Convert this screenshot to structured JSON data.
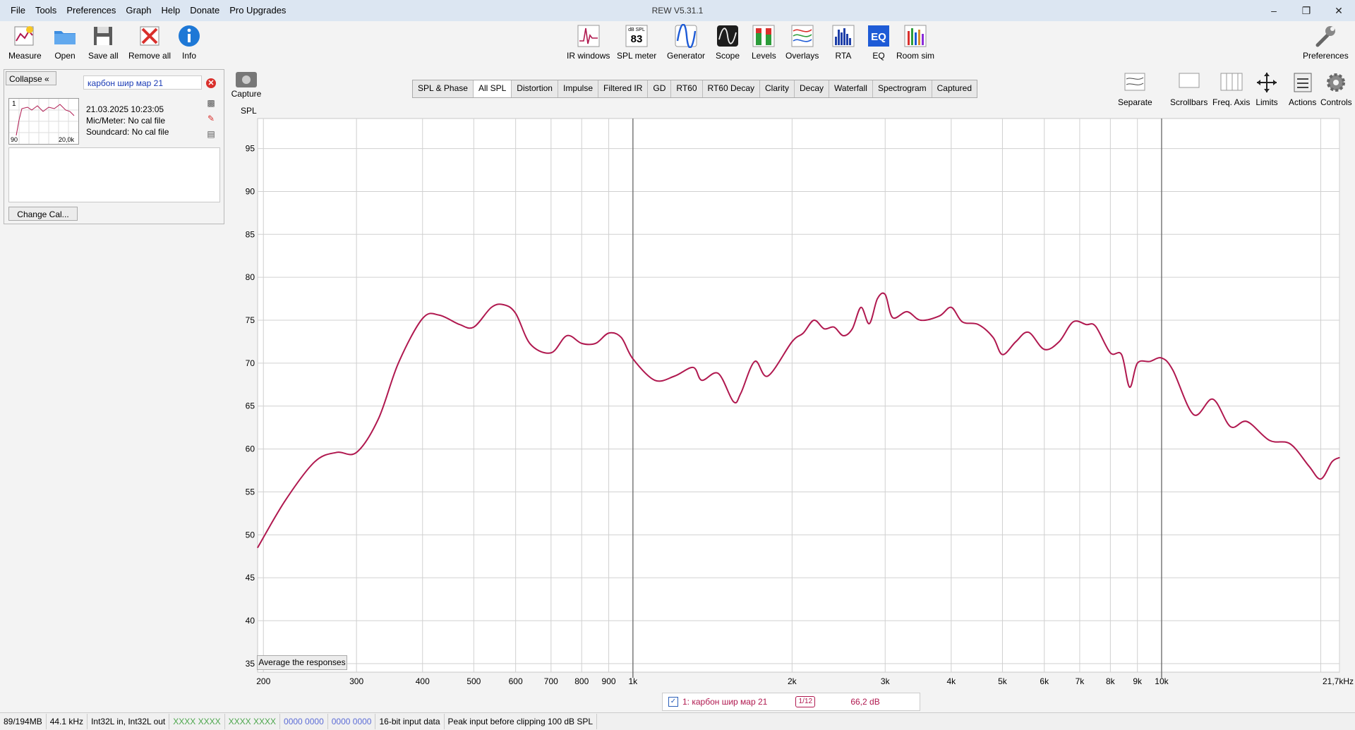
{
  "app": {
    "title": "REW V5.31.1",
    "menu": [
      "File",
      "Tools",
      "Preferences",
      "Graph",
      "Help",
      "Donate",
      "Pro Upgrades"
    ],
    "window_controls": [
      "minimize",
      "restore",
      "close"
    ]
  },
  "toolbar": {
    "left": [
      {
        "label": "Measure",
        "icon": "measure-icon"
      },
      {
        "label": "Open",
        "icon": "folder-icon"
      },
      {
        "label": "Save all",
        "icon": "save-icon"
      },
      {
        "label": "Remove all",
        "icon": "remove-icon"
      },
      {
        "label": "Info",
        "icon": "info-icon"
      }
    ],
    "center": [
      {
        "label": "IR windows",
        "icon": "ir-windows-icon"
      },
      {
        "label": "SPL meter",
        "icon": "spl-meter-icon",
        "badge_top": "dB SPL",
        "badge_value": "83"
      },
      {
        "label": "Generator",
        "icon": "generator-icon"
      },
      {
        "label": "Scope",
        "icon": "scope-icon"
      },
      {
        "label": "Levels",
        "icon": "levels-icon"
      },
      {
        "label": "Overlays",
        "icon": "overlays-icon"
      },
      {
        "label": "RTA",
        "icon": "rta-icon"
      },
      {
        "label": "EQ",
        "icon": "eq-icon"
      },
      {
        "label": "Room sim",
        "icon": "room-sim-icon"
      }
    ],
    "right": [
      {
        "label": "Preferences",
        "icon": "wrench-icon"
      }
    ]
  },
  "panel": {
    "collapse_label": "Collapse",
    "measurement_name": "карбон шир мар 21",
    "thumb_index": "1",
    "thumb_left": "90",
    "thumb_right": "20,0k",
    "info": [
      "21.03.2025 10:23:05",
      "Mic/Meter: No cal file",
      "Soundcard: No cal file"
    ],
    "change_cal_label": "Change Cal..."
  },
  "capture_label": "Capture",
  "tabs": [
    "SPL & Phase",
    "All SPL",
    "Distortion",
    "Impulse",
    "Filtered IR",
    "GD",
    "RT60",
    "RT60 Decay",
    "Clarity",
    "Decay",
    "Waterfall",
    "Spectrogram",
    "Captured"
  ],
  "active_tab": "All SPL",
  "graph_controls": [
    "Separate",
    "Scrollbars",
    "Freq. Axis",
    "Limits",
    "Actions",
    "Controls"
  ],
  "average_label": "Average the responses",
  "legend": {
    "name": "1: карбон шир мар 21",
    "smoothing_num": "1",
    "smoothing_den": "12",
    "value": "66,2 dB",
    "checked": "✓"
  },
  "status": [
    "89/194MB",
    "44.1 kHz",
    "Int32L in, Int32L out",
    "XXXX XXXX",
    "XXXX XXXX",
    "0000 0000",
    "0000 0000",
    "16-bit input data",
    "Peak input before clipping 100 dB SPL"
  ],
  "chart_data": {
    "type": "line",
    "ylabel": "SPL",
    "xscale": "log",
    "xlim": [
      195,
      21700
    ],
    "ylim": [
      34,
      98.5
    ],
    "y_ticks": [
      35,
      40,
      45,
      50,
      55,
      60,
      65,
      70,
      75,
      80,
      85,
      90,
      95
    ],
    "x_ticks": [
      {
        "v": 200,
        "l": "200"
      },
      {
        "v": 300,
        "l": "300"
      },
      {
        "v": 400,
        "l": "400"
      },
      {
        "v": 500,
        "l": "500"
      },
      {
        "v": 600,
        "l": "600"
      },
      {
        "v": 700,
        "l": "700"
      },
      {
        "v": 800,
        "l": "800"
      },
      {
        "v": 900,
        "l": "900"
      },
      {
        "v": 1000,
        "l": "1k"
      },
      {
        "v": 2000,
        "l": "2k"
      },
      {
        "v": 3000,
        "l": "3k"
      },
      {
        "v": 4000,
        "l": "4k"
      },
      {
        "v": 5000,
        "l": "5k"
      },
      {
        "v": 6000,
        "l": "6k"
      },
      {
        "v": 7000,
        "l": "7k"
      },
      {
        "v": 8000,
        "l": "8k"
      },
      {
        "v": 9000,
        "l": "9k"
      },
      {
        "v": 10000,
        "l": "10k"
      },
      {
        "v": 21700,
        "l": "21,7kHz"
      }
    ],
    "x_ticks_minor": [
      20000
    ],
    "series": [
      {
        "color": "#b0184f",
        "x": [
          195,
          220,
          250,
          275,
          300,
          330,
          360,
          400,
          430,
          470,
          500,
          540,
          570,
          600,
          640,
          700,
          750,
          800,
          850,
          900,
          950,
          1000,
          1100,
          1200,
          1300,
          1350,
          1450,
          1550,
          1600,
          1700,
          1800,
          2000,
          2100,
          2200,
          2300,
          2400,
          2500,
          2600,
          2700,
          2800,
          2900,
          3000,
          3100,
          3300,
          3500,
          3800,
          4000,
          4200,
          4500,
          4800,
          5000,
          5300,
          5600,
          6000,
          6400,
          6800,
          7200,
          7500,
          8000,
          8400,
          8700,
          9000,
          9500,
          10000,
          10500,
          11500,
          12500,
          13500,
          14500,
          16000,
          17500,
          19000,
          20000,
          21000,
          21700
        ],
        "y": [
          48.5,
          54,
          58.5,
          59.6,
          59.6,
          63.5,
          70,
          75.2,
          75.6,
          74.5,
          74.2,
          76.5,
          76.8,
          75.8,
          72.2,
          71.2,
          73.2,
          72.3,
          72.3,
          73.5,
          73,
          70.5,
          68,
          68.5,
          69.5,
          68,
          68.8,
          65.5,
          66.5,
          70.2,
          68.5,
          72.5,
          73.5,
          75,
          74,
          74.2,
          73.2,
          74,
          76.5,
          74.6,
          77.5,
          78,
          75.3,
          76,
          75,
          75.5,
          76.5,
          74.8,
          74.5,
          73,
          71,
          72.5,
          73.6,
          71.6,
          72.5,
          74.8,
          74.5,
          74.3,
          71.2,
          71,
          67.2,
          70,
          70.2,
          70.6,
          69.2,
          64,
          65.8,
          62.6,
          63.2,
          61,
          60.6,
          58,
          56.5,
          58.5,
          59
        ]
      }
    ]
  }
}
